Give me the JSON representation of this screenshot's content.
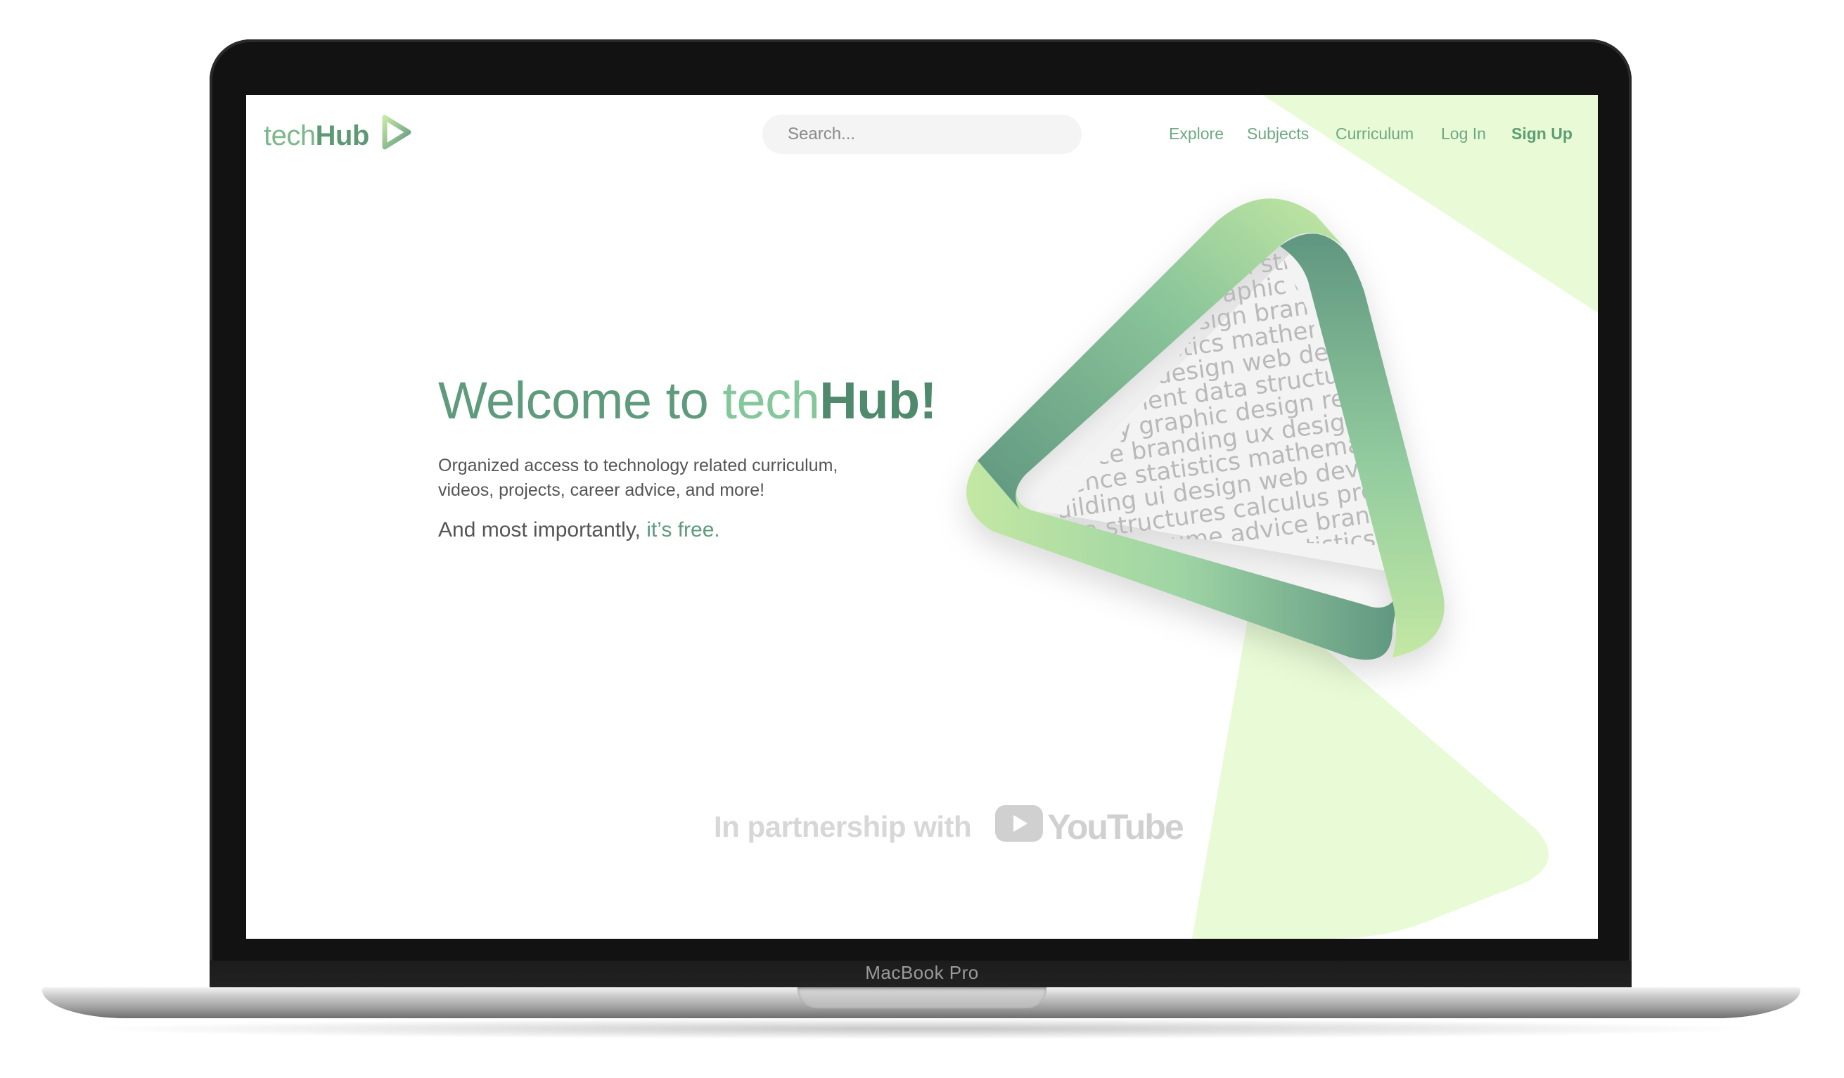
{
  "device": {
    "model_label": "MacBook Pro"
  },
  "header": {
    "logo_light": "tech",
    "logo_bold": "Hub",
    "search_placeholder": "Search...",
    "nav": {
      "explore": "Explore",
      "subjects": "Subjects",
      "curriculum": "Curriculum",
      "login": "Log In",
      "signup": "Sign Up"
    }
  },
  "hero": {
    "headline_prefix": "Welcome to ",
    "headline_tech": "tech",
    "headline_hub": "Hub!",
    "subtitle": "Organized access to technology related curriculum, videos, projects, career advice, and more!",
    "tagline_prefix": "And most importantly, ",
    "tagline_accent": "it’s free."
  },
  "partner": {
    "text": "In partnership with",
    "brand": "YouTube"
  },
  "triangle_words": [
    "building",
    "data structures",
    "graphic design",
    "branding ux design",
    "science statistics mathematics",
    "building ui design web development",
    "management data structures",
    "usability graphic design resume",
    "science branding ux design computer",
    "science statistics mathematics",
    "building ui design web development",
    "data structures calculus probability",
    "design resume advice branding",
    "computer science statistics",
    "building ui design",
    "data structures"
  ],
  "colors": {
    "accent": "#5e9b7d",
    "accent_light": "#84c79a",
    "lime": "#e8fbd6",
    "ribbon_light": "#c3e8a3",
    "ribbon_dark": "#5f9680"
  },
  "icons": {
    "logo": "play-triangle-icon",
    "partner": "youtube-play-icon"
  }
}
